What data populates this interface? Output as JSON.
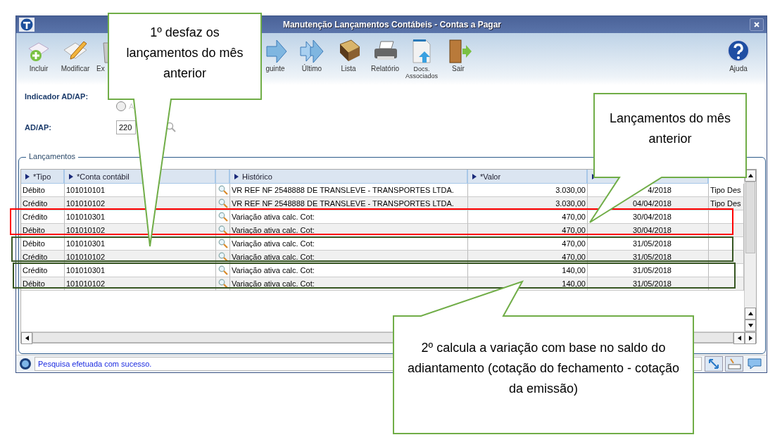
{
  "window": {
    "title": "Manutenção Lançamentos Contábeis - Contas a Pagar"
  },
  "toolbar": [
    {
      "kind": "add",
      "label": "Incluir"
    },
    {
      "kind": "edit",
      "label": "Modificar"
    },
    {
      "kind": "delete",
      "label": "Ex"
    },
    {
      "kind": "next",
      "label": "guinte"
    },
    {
      "kind": "last",
      "label": "Último"
    },
    {
      "kind": "list",
      "label": "Lista"
    },
    {
      "kind": "report",
      "label": "Relatório"
    },
    {
      "kind": "docs",
      "label": "Docs. Associados"
    },
    {
      "kind": "exit",
      "label": "Sair"
    },
    {
      "kind": "help",
      "label": "Ajuda"
    }
  ],
  "form": {
    "indicator_label": "Indicador AD/AP:",
    "radios": [
      {
        "selected": false,
        "label": "A"
      }
    ],
    "adap_label": "AD/AP:",
    "adap_value": "220"
  },
  "group": {
    "title": "Lançamentos"
  },
  "table": {
    "columns": [
      {
        "label": "*Tipo"
      },
      {
        "label": "*Conta contábil"
      },
      {
        "kind": "icon"
      },
      {
        "label": "Histórico"
      },
      {
        "label": "*Valor"
      },
      {
        "kind": "hidden"
      }
    ],
    "rows": [
      {
        "tipo": "Débito",
        "conta": "101010101",
        "historico": "VR REF NF 2548888 DE TRANSLEVE - TRANSPORTES LTDA.",
        "valor": "3.030,00",
        "data": "4/2018",
        "column_7": "Tipo Des"
      },
      {
        "tipo": "Crédito",
        "conta": "101010102",
        "historico": "VR REF NF 2548888 DE TRANSLEVE - TRANSPORTES LTDA.",
        "valor": "3.030,00",
        "data": "04/04/2018",
        "column_7": "Tipo Des"
      },
      {
        "tipo": "Crédito",
        "conta": "101010301",
        "historico": "Variação ativa calc. Cot:",
        "valor": "470,00",
        "data": "30/04/2018"
      },
      {
        "tipo": "Débito",
        "conta": "101010102",
        "historico": "Variação ativa calc. Cot:",
        "valor": "470,00",
        "data": "30/04/2018"
      },
      {
        "tipo": "Débito",
        "conta": "101010301",
        "historico": "Variação ativa calc. Cot:",
        "valor": "470,00",
        "data": "31/05/2018"
      },
      {
        "tipo": "Crédito",
        "conta": "101010102",
        "historico": "Variação ativa calc. Cot:",
        "valor": "470,00",
        "data": "31/05/2018"
      },
      {
        "tipo": "Crédito",
        "conta": "101010301",
        "historico": "Variação ativa calc. Cot:",
        "valor": "140,00",
        "data": "31/05/2018"
      },
      {
        "tipo": "Débito",
        "conta": "101010102",
        "historico": "Variação ativa calc. Cot:",
        "valor": "140,00",
        "data": "31/05/2018"
      }
    ]
  },
  "status_bar": {
    "message": "Pesquisa efetuada com sucesso."
  },
  "highlights": [
    {
      "color": "#ff0000"
    },
    {
      "color": "#375623"
    },
    {
      "color": "#375623"
    }
  ],
  "callouts": [
    {
      "text": "1º desfaz os lançamentos do mês anterior"
    },
    {
      "text": "Lançamentos do mês anterior"
    },
    {
      "text": "2º calcula a variação com base no saldo do adiantamento (cotação do fechamento - cotação da emissão)"
    }
  ]
}
